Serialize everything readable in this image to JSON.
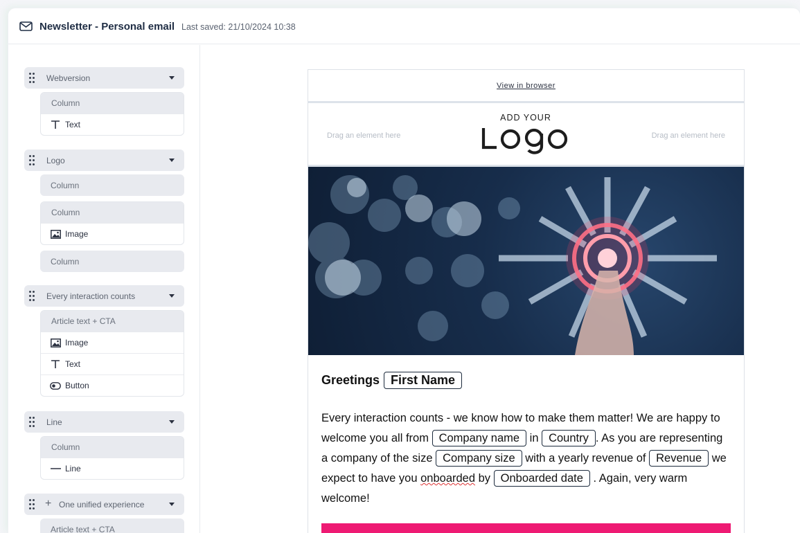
{
  "header": {
    "title": "Newsletter - Personal email",
    "last_saved": "Last saved: 21/10/2024 10:38"
  },
  "sidebar": {
    "blocks": [
      {
        "label": "Webversion",
        "columns": [
          {
            "head": "Column",
            "items": [
              {
                "icon": "text-icon",
                "label": "Text"
              }
            ]
          }
        ]
      },
      {
        "label": "Logo",
        "columns": [
          {
            "head": "Column",
            "items": []
          },
          {
            "head": "Column",
            "items": [
              {
                "icon": "image-icon",
                "label": "Image"
              }
            ]
          },
          {
            "head": "Column",
            "items": []
          }
        ]
      },
      {
        "label": "Every interaction counts",
        "columns": [
          {
            "head": "Article text + CTA",
            "items": [
              {
                "icon": "image-icon",
                "label": "Image"
              },
              {
                "icon": "text-icon",
                "label": "Text"
              },
              {
                "icon": "button-icon",
                "label": "Button"
              }
            ]
          }
        ]
      },
      {
        "label": "Line",
        "columns": [
          {
            "head": "Column",
            "items": [
              {
                "icon": "line-icon",
                "label": "Line"
              }
            ]
          }
        ]
      },
      {
        "label": "One unified experience",
        "columns": [
          {
            "head": "Article text + CTA",
            "items": []
          }
        ]
      }
    ]
  },
  "email": {
    "view_in_browser": "View in browser",
    "drag_left": "Drag an element here",
    "drag_right": "Drag an element here",
    "logo_small": "ADD YOUR",
    "logo_big": "Logo",
    "greeting": "Greetings",
    "first_name_tag": "First Name",
    "p1": "Every interaction counts - we know how to make them matter! We are happy to welcome you all from",
    "company_name_tag": "Company name",
    "in": "in",
    "country_tag": "Country",
    "p2": ". As you are representing a company of the size",
    "company_size_tag": "Company size",
    "p3": "with a yearly revenue of",
    "revenue_tag": "Revenue",
    "p4": "we expect to have you",
    "onboarded_word": "onboarded",
    "p5": "by",
    "onboarded_date_tag": "Onboarded date",
    "p6": ". Again, very warm welcome!"
  },
  "colors": {
    "accent_pink": "#ee1a73",
    "title_navy": "#1f2d44"
  }
}
